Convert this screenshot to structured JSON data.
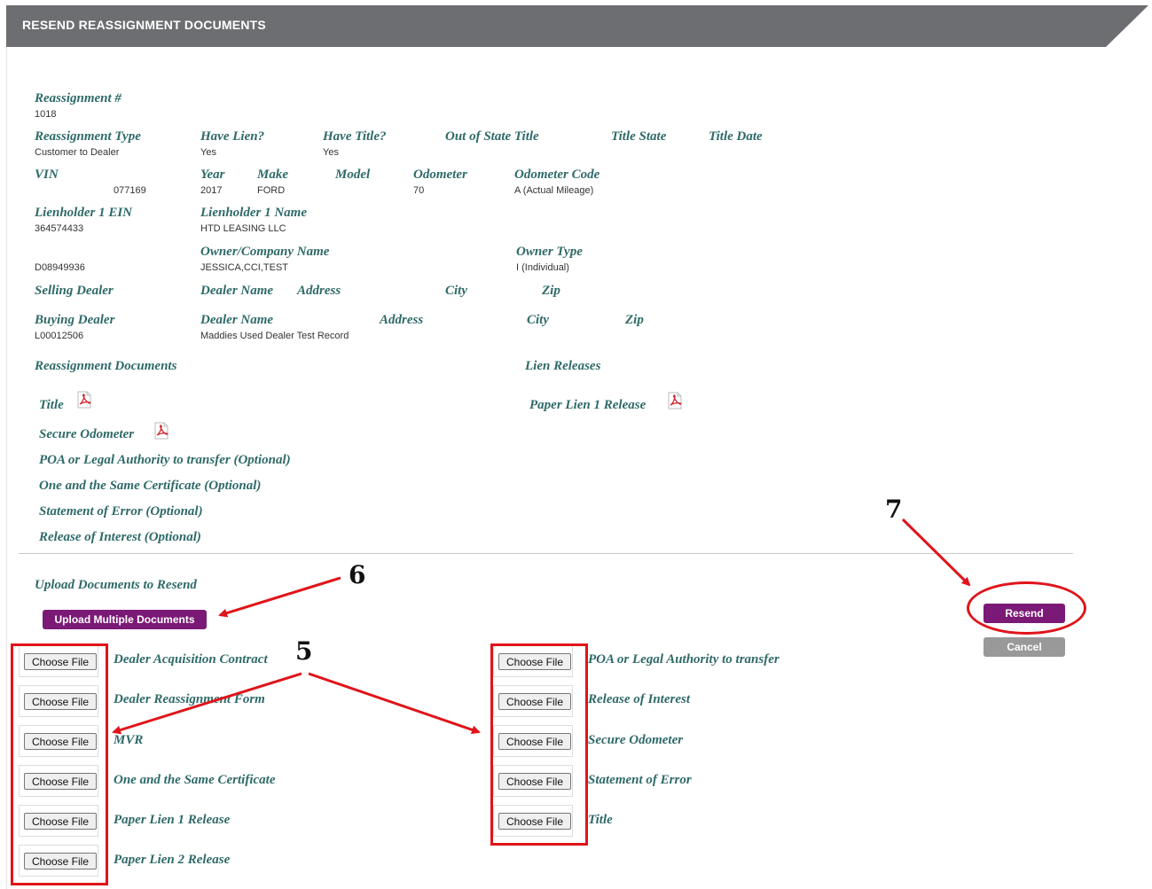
{
  "header": {
    "title": "RESEND REASSIGNMENT DOCUMENTS"
  },
  "details": {
    "reassignment_no": {
      "label": "Reassignment #",
      "value": "1018"
    },
    "reassignment_type": {
      "label": "Reassignment Type",
      "value": "Customer to Dealer"
    },
    "have_lien": {
      "label": "Have Lien?",
      "value": "Yes"
    },
    "have_title": {
      "label": "Have Title?",
      "value": "Yes"
    },
    "out_of_state_title": {
      "label": "Out of State Title",
      "value": ""
    },
    "title_state": {
      "label": "Title State",
      "value": ""
    },
    "title_date": {
      "label": "Title Date",
      "value": ""
    },
    "vin": {
      "label": "VIN",
      "value": "077169"
    },
    "year": {
      "label": "Year",
      "value": "2017"
    },
    "make": {
      "label": "Make",
      "value": "FORD"
    },
    "model": {
      "label": "Model",
      "value": ""
    },
    "odometer": {
      "label": "Odometer",
      "value": "70"
    },
    "odometer_code": {
      "label": "Odometer Code",
      "value": "A (Actual Mileage)"
    },
    "lienholder1_ein": {
      "label": "Lienholder 1 EIN",
      "value": "364574433"
    },
    "lienholder1_name": {
      "label": "Lienholder 1 Name",
      "value": "HTD LEASING LLC"
    },
    "owner_id": {
      "label": "",
      "value": "D08949936"
    },
    "owner_company_name": {
      "label": "Owner/Company Name",
      "value": "JESSICA,CCI,TEST"
    },
    "owner_type": {
      "label": "Owner Type",
      "value": "I (Individual)"
    },
    "selling_dealer": {
      "label": "Selling Dealer",
      "dealer_name": "Dealer Name",
      "address": "Address",
      "city": "City",
      "zip": "Zip"
    },
    "buying_dealer": {
      "label": "Buying Dealer",
      "value": "L00012506",
      "dealer_name": "Dealer Name",
      "dealer_name_value": "Maddies Used Dealer Test Record",
      "address": "Address",
      "city": "City",
      "zip": "Zip"
    }
  },
  "reassignment_documents": {
    "heading": "Reassignment Documents",
    "items": [
      "Title",
      "Secure Odometer",
      "POA or Legal Authority to transfer (Optional)",
      "One and the Same Certificate (Optional)",
      "Statement of Error (Optional)",
      "Release of Interest (Optional)"
    ]
  },
  "lien_releases": {
    "heading": "Lien Releases",
    "items": [
      "Paper Lien 1 Release"
    ]
  },
  "upload": {
    "heading": "Upload Documents to Resend",
    "multi_button": "Upload Multiple Documents",
    "choose_label": "Choose File",
    "left_docs": [
      "Dealer Acquisition Contract",
      "Dealer Reassignment Form",
      "MVR",
      "One and the Same Certificate",
      "Paper Lien 1 Release",
      "Paper Lien 2 Release"
    ],
    "right_docs": [
      "POA or Legal Authority to transfer",
      "Release of Interest",
      "Secure Odometer",
      "Statement of Error",
      "Title"
    ]
  },
  "actions": {
    "resend": "Resend",
    "cancel": "Cancel"
  },
  "annotations": {
    "callout_5": "5",
    "callout_6": "6",
    "callout_7": "7"
  },
  "colors": {
    "banner": "#6d6e71",
    "label": "#2e6a68",
    "purple": "#7b1a76",
    "annotation_red": "#e0141a"
  },
  "icons": {
    "pdf": "pdf-icon"
  }
}
